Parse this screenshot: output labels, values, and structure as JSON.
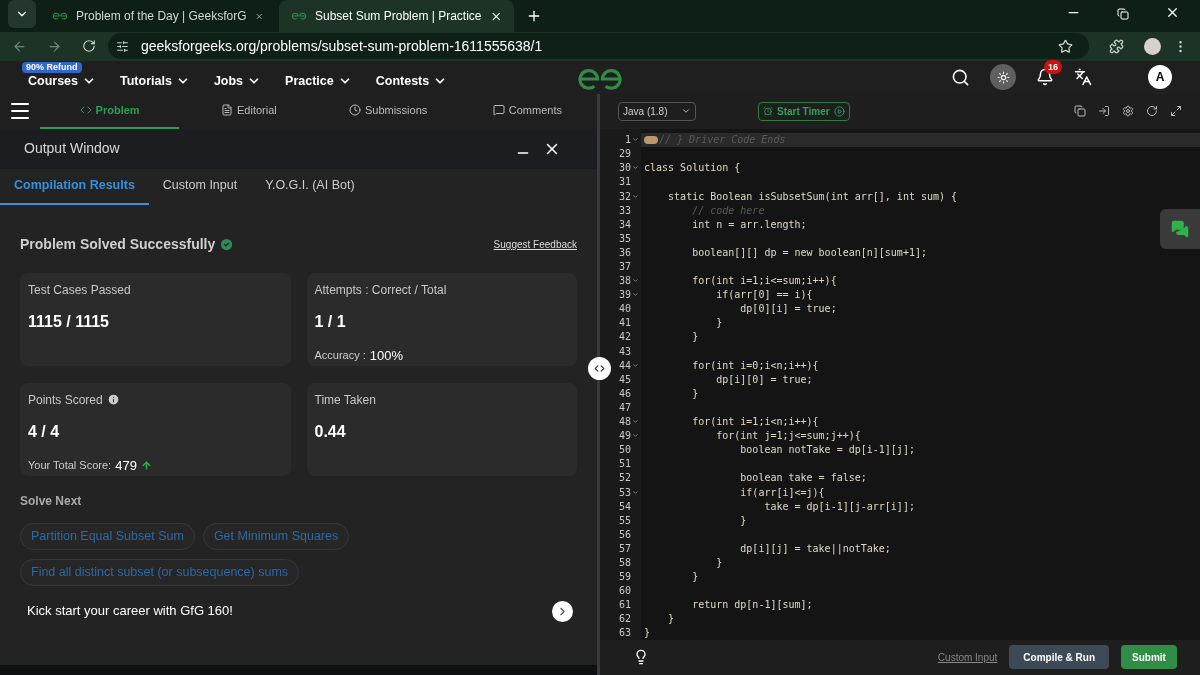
{
  "browser": {
    "tabs": [
      {
        "title": "Problem of the Day | GeeksforG",
        "selected": false
      },
      {
        "title": "Subset Sum Problem | Practice",
        "selected": true
      }
    ],
    "url": "geeksforgeeks.org/problems/subset-sum-problem-1611555638/1"
  },
  "navbar": {
    "badge": "90% Refund",
    "menu": [
      "Courses",
      "Tutorials",
      "Jobs",
      "Practice",
      "Contests"
    ],
    "notification_count": "16",
    "avatar": "A"
  },
  "problem_tabs": [
    {
      "label": "Problem",
      "selected": true
    },
    {
      "label": "Editorial",
      "selected": false
    },
    {
      "label": "Submissions",
      "selected": false
    },
    {
      "label": "Comments",
      "selected": false
    }
  ],
  "output_window": {
    "title": "Output Window",
    "tabs": [
      {
        "label": "Compilation Results",
        "selected": true
      },
      {
        "label": "Custom Input",
        "selected": false
      },
      {
        "label": "Y.O.G.I. (AI Bot)",
        "selected": false
      }
    ],
    "status": "Problem Solved Successfully",
    "feedback_link": "Suggest Feedback",
    "cards": [
      {
        "label": "Test Cases Passed",
        "value": "1115 / 1115"
      },
      {
        "label": "Attempts : Correct / Total",
        "value": "1 / 1",
        "note_label": "Accuracy :",
        "note_value": "100%"
      },
      {
        "label": "Points Scored",
        "value": "4 / 4",
        "note_label": "Your Total Score:",
        "note_value": "479",
        "info": true,
        "trend_up": true
      },
      {
        "label": "Time Taken",
        "value": "0.44"
      }
    ],
    "solve_next": {
      "title": "Solve Next",
      "problems": [
        "Partition Equal Subset Sum",
        "Get Minimum Squares",
        "Find all distinct subset (or subsequence) sums"
      ]
    },
    "promo": "Kick start your career with GfG 160!"
  },
  "editor": {
    "language": "Java (1.8)",
    "timer": "Start Timer",
    "lines": [
      {
        "number": "1",
        "text": "// } Driver Code Ends",
        "kind": "comment",
        "foldable": true,
        "folded": true
      },
      {
        "number": "29"
      },
      {
        "number": "30",
        "text": "class Solution {",
        "foldable": true
      },
      {
        "number": "31"
      },
      {
        "number": "32",
        "text": "    static Boolean isSubsetSum(int arr[], int sum) {",
        "foldable": true
      },
      {
        "number": "33",
        "text": "        // code here",
        "kind": "comment"
      },
      {
        "number": "34",
        "text": "        int n = arr.length;"
      },
      {
        "number": "35"
      },
      {
        "number": "36",
        "text": "        boolean[][] dp = new boolean[n][sum+1];"
      },
      {
        "number": "37"
      },
      {
        "number": "38",
        "text": "        for(int i=1;i<=sum;i++){",
        "foldable": true
      },
      {
        "number": "39",
        "text": "            if(arr[0] == i){",
        "foldable": true
      },
      {
        "number": "40",
        "text": "                dp[0][i] = true;"
      },
      {
        "number": "41",
        "text": "            }"
      },
      {
        "number": "42",
        "text": "        }"
      },
      {
        "number": "43"
      },
      {
        "number": "44",
        "text": "        for(int i=0;i<n;i++){",
        "foldable": true
      },
      {
        "number": "45",
        "text": "            dp[i][0] = true;"
      },
      {
        "number": "46",
        "text": "        }"
      },
      {
        "number": "47"
      },
      {
        "number": "48",
        "text": "        for(int i=1;i<n;i++){",
        "foldable": true
      },
      {
        "number": "49",
        "text": "            for(int j=1;j<=sum;j++){",
        "foldable": true
      },
      {
        "number": "50",
        "text": "                boolean notTake = dp[i-1][j];"
      },
      {
        "number": "51"
      },
      {
        "number": "52",
        "text": "                boolean take = false;"
      },
      {
        "number": "53",
        "text": "                if(arr[i]<=j){",
        "foldable": true
      },
      {
        "number": "54",
        "text": "                    take = dp[i-1][j-arr[i]];"
      },
      {
        "number": "55",
        "text": "                }"
      },
      {
        "number": "56"
      },
      {
        "number": "57",
        "text": "                dp[i][j] = take||notTake;"
      },
      {
        "number": "58",
        "text": "            }"
      },
      {
        "number": "59",
        "text": "        }"
      },
      {
        "number": "60"
      },
      {
        "number": "61",
        "text": "        return dp[n-1][sum];"
      },
      {
        "number": "62",
        "text": "    }"
      },
      {
        "number": "63",
        "text": "}"
      }
    ],
    "custom_input": "Custom Input",
    "compile": "Compile & Run",
    "submit": "Submit"
  }
}
